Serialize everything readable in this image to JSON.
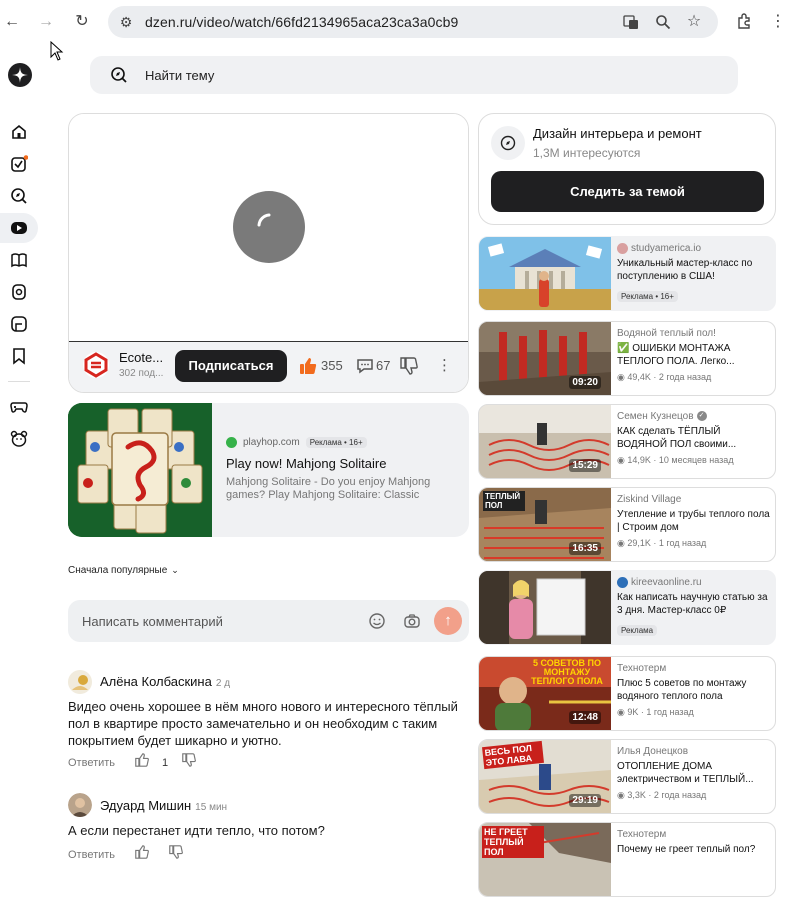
{
  "browser": {
    "url": "dzen.ru/video/watch/66fd2134965aca23ca3a0cb9"
  },
  "search": {
    "placeholder": "Найти тему"
  },
  "video": {
    "channel_name": "Ecote...",
    "channel_subs": "302 под...",
    "subscribe_label": "Подписаться",
    "likes": "355",
    "comments": "67"
  },
  "ad": {
    "domain": "playhop.com",
    "badge": "Реклама • 16+",
    "title": "Play now! Mahjong Solitaire",
    "description": "Mahjong Solitaire - Do you enjoy Mahjong games? Play Mahjong Solitaire: Classic"
  },
  "comments_section": {
    "sort_label": "Сначала популярные",
    "input_placeholder": "Написать комментарий",
    "items": [
      {
        "author": "Алёна Колбаскина",
        "time": "2 д",
        "text": "Видео очень хорошее в нём много нового и интересного тёплый пол в квартире просто замечательно и он необходим с таким покрытием будет шикарно и уютно.",
        "reply_label": "Ответить",
        "likes": "1"
      },
      {
        "author": "Эдуард Мишин",
        "time": "15 мин",
        "text": "А если перестанет идти тепло, что потом?",
        "reply_label": "Ответить"
      }
    ]
  },
  "topic": {
    "title": "Дизайн интерьера и ремонт",
    "subtitle": "1,3М интересуются",
    "follow_label": "Следить за темой"
  },
  "recommendations": [
    {
      "channel": "studyamerica.io",
      "title": "Уникальный мастер-класс по поступлению в США!",
      "stats": "",
      "badge": "Реклама • 16+",
      "is_ad": true
    },
    {
      "channel": "Водяной теплый пол!",
      "title": "✅ ОШИБКИ МОНТАЖА ТЕПЛОГО ПОЛА. Легко...",
      "duration": "09:20",
      "stats": "49,4K · 2 года назад"
    },
    {
      "channel": "Семен Кузнецов",
      "title": "КАК сделать ТЁПЛЫЙ ВОДЯНОЙ ПОЛ своими...",
      "duration": "15:29",
      "stats": "14,9K · 10 месяцев назад"
    },
    {
      "channel": "Ziskind Village",
      "title": "Утепление и трубы теплого пола | Строим дом",
      "duration": "16:35",
      "stats": "29,1K · 1 год назад",
      "thumb_text": "ТЕПЛЫЙ ПОЛ"
    },
    {
      "channel": "kireevaonline.ru",
      "title": "Как написать научную статью за 3 дня. Мастер-класс 0₽",
      "stats": "",
      "badge": "Реклама",
      "is_ad": true
    },
    {
      "channel": "Технотерм",
      "title": "Плюс 5 советов по монтажу водяного теплого пола",
      "duration": "12:48",
      "stats": "9K · 1 год назад",
      "thumb_text": "5 СОВЕТОВ ПО МОНТАЖУ ТЕПЛОГО ПОЛА"
    },
    {
      "channel": "Илья Донецков",
      "title": "ОТОПЛЕНИЕ ДОМА электричеством и ТЕПЛЫЙ...",
      "duration": "29:19",
      "stats": "3,3K · 2 года назад",
      "thumb_text": "ВЕСЬ ПОЛ ЭТО ЛАВА"
    },
    {
      "channel": "Технотерм",
      "title": "Почему не греет теплый пол?",
      "stats": "",
      "thumb_text": "НЕ ГРЕЕТ ТЕПЛЫЙ ПОЛ"
    }
  ],
  "colors": {
    "accent_dark": "#1f1f21",
    "like_orange": "#f26b1d",
    "send_button": "#f2a08a"
  }
}
